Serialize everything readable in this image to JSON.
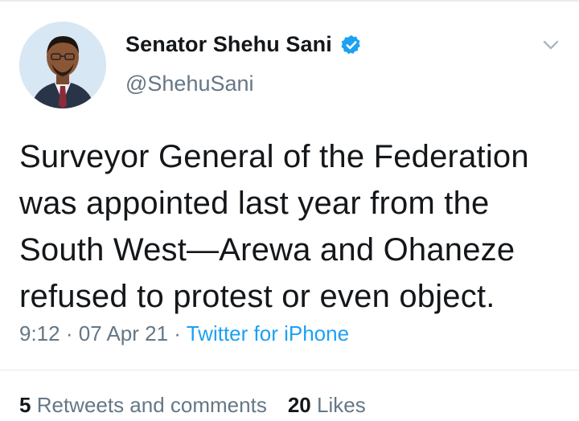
{
  "tweet": {
    "display_name": "Senator Shehu Sani",
    "handle": "@ShehuSani",
    "text_lines": [
      "Surveyor General of the Federation",
      "was appointed last year from the",
      "South West—Arewa and Ohaneze",
      "refused to protest or even object."
    ],
    "time": "9:12",
    "separator": "·",
    "date": "07 Apr 21",
    "source": "Twitter for iPhone"
  },
  "stats": {
    "retweets_count": "5",
    "retweets_label": "Retweets and comments",
    "likes_count": "20",
    "likes_label": "Likes"
  },
  "icons": {
    "verified": "verified-badge-icon",
    "menu": "chevron-down-icon"
  },
  "colors": {
    "accent": "#1da1f2",
    "secondary_text": "#657786",
    "primary_text": "#14171a"
  }
}
